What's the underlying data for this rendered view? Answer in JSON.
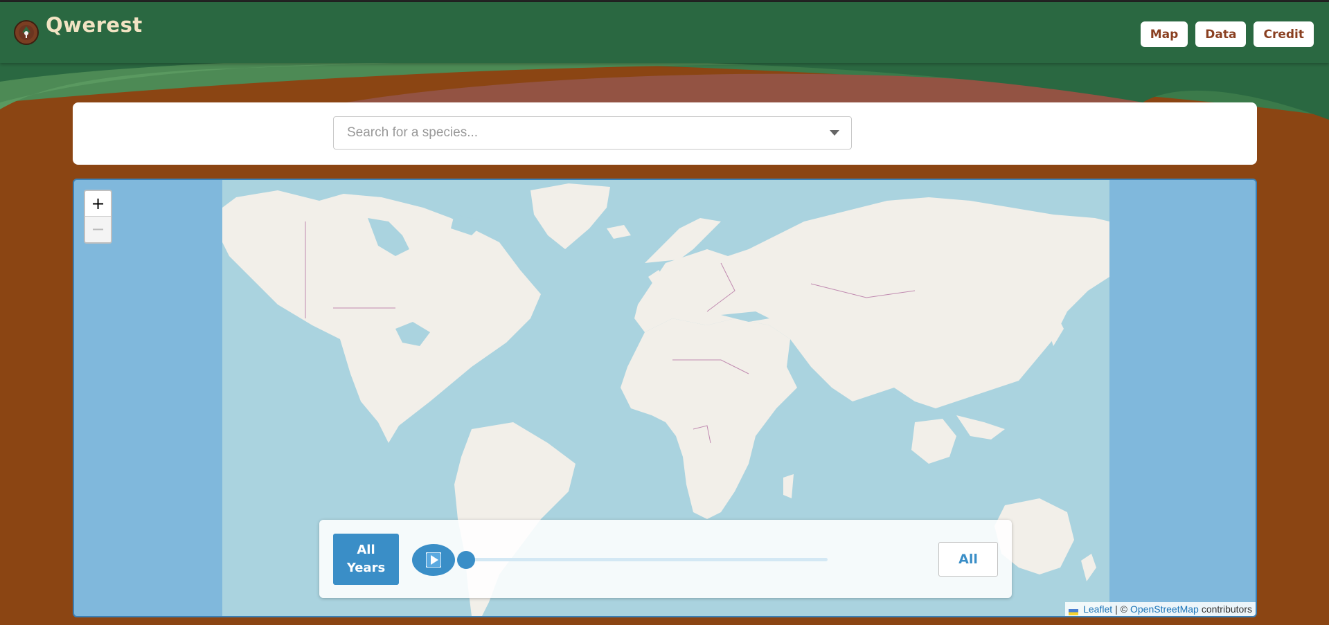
{
  "header": {
    "brand": "Qwerest",
    "nav": [
      {
        "label": "Map"
      },
      {
        "label": "Data"
      },
      {
        "label": "Credit"
      }
    ]
  },
  "search": {
    "placeholder": "Search for a species...",
    "value": ""
  },
  "map": {
    "zoom_in_label": "+",
    "zoom_out_label": "−",
    "attribution": {
      "leaflet_label": "Leaflet",
      "separator": "| ©",
      "osm_label": "OpenStreetMap",
      "suffix": "contributors"
    }
  },
  "timeline": {
    "all_years_line1": "All",
    "all_years_line2": "Years",
    "current_label": "All",
    "slider_position": 0
  },
  "colors": {
    "header_green": "#2a6841",
    "soil_brown": "#8b4513",
    "accent_blue": "#3a8ec7",
    "ocean": "#aad3df",
    "land": "#f2efe9",
    "border": "#c08ab0"
  }
}
